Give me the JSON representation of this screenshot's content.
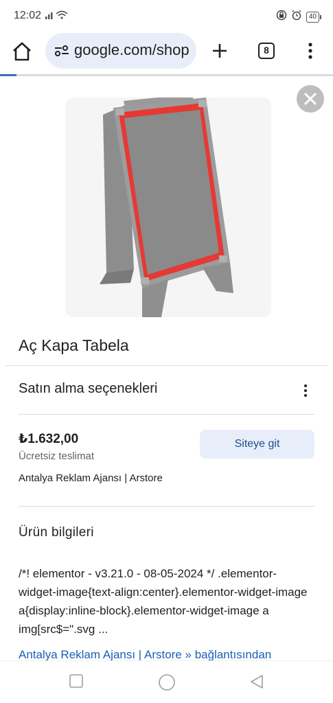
{
  "status_bar": {
    "time": "12:02",
    "battery": "40",
    "icons": [
      "signal-icon",
      "wifi-icon",
      "lock-icon",
      "alarm-icon",
      "battery-icon"
    ]
  },
  "browser": {
    "url": "google.com/shop",
    "tab_count": "8",
    "load_progress": 0.05,
    "icons": [
      "home-icon",
      "site-settings-icon",
      "new-tab-icon",
      "tabs-icon",
      "more-menu-icon"
    ]
  },
  "product": {
    "title": "Aç Kapa Tabela",
    "image_alt": "close-icon"
  },
  "purchase": {
    "heading": "Satın alma seçenekleri",
    "price": "₺1.632,00",
    "delivery": "Ücretsiz teslimat",
    "cta_label": "Siteye git",
    "seller": "Antalya Reklam Ajansı | Arstore"
  },
  "info": {
    "heading": "Ürün bilgileri",
    "description": "/*! elementor - v3.21.0 - 08-05-2024 */ .elementor-widget-image{text-align:center}.elementor-widget-image a{display:inline-block}.elementor-widget-image a img[src$=\".svg ...",
    "source_link": "Antalya Reklam Ajansı | Arstore » bağlantısından"
  },
  "colors": {
    "accent_pill": "#e8eef9",
    "link": "#1a5fb4",
    "sign_frame": "#e53935"
  },
  "navbar": {
    "icons": [
      "recent-apps-icon",
      "home-circle-icon",
      "back-icon"
    ]
  }
}
